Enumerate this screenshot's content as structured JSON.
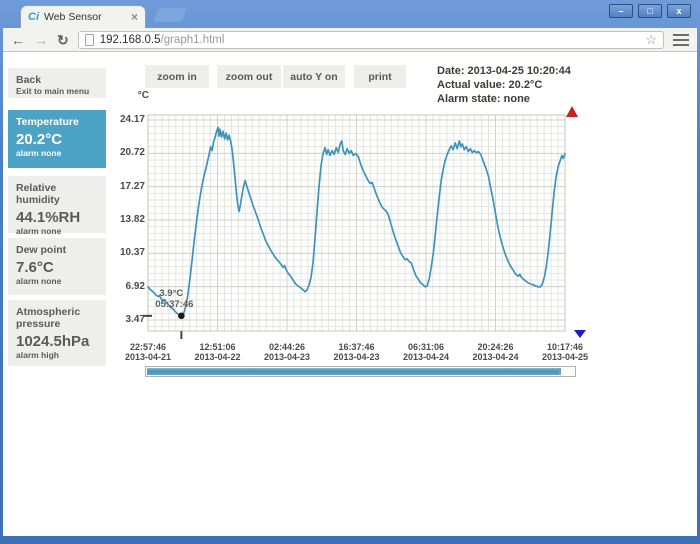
{
  "browser": {
    "tab_title": "Web Sensor",
    "url_host": "192.168.0.5",
    "url_path": "/graph1.html",
    "icons": {
      "favicon": "Ci",
      "tab_close": "×",
      "back": "←",
      "forward": "→",
      "reload": "↻",
      "star": "☆",
      "minimize": "–",
      "maximize": "□",
      "close": "x"
    }
  },
  "sidebar": {
    "back": {
      "label": "Back",
      "sublabel": "Exit to main menu"
    },
    "items": [
      {
        "label": "Temperature",
        "value": "20.2°C",
        "alarm": "alarm none",
        "selected": true
      },
      {
        "label": "Relative humidity",
        "value": "44.1%RH",
        "alarm": "alarm none",
        "selected": false
      },
      {
        "label": "Dew point",
        "value": "7.6°C",
        "alarm": "alarm none",
        "selected": false
      },
      {
        "label": "Atmospheric pressure",
        "value": "1024.5hPa",
        "alarm": "alarm high",
        "selected": false
      }
    ]
  },
  "buttons": [
    "zoom in",
    "zoom out",
    "auto Y on",
    "print"
  ],
  "status": {
    "date_line": "Date: 2013-04-25 10:20:44",
    "value_line": "Actual value: 20.2°C",
    "alarm_line": "Alarm state: none"
  },
  "colors": {
    "accent": "#4da3c6",
    "line": "#3e93bd",
    "up_arrow": "#c42420",
    "down_arrow": "#1d1dc4"
  },
  "chart_data": {
    "type": "line",
    "title": "",
    "xlabel": "",
    "ylabel": "°C",
    "unit_label": "°C",
    "grid": true,
    "legend": "none",
    "y_ticks": [
      24.17,
      20.72,
      17.27,
      13.82,
      10.37,
      6.92,
      3.47
    ],
    "y_tick_labels": [
      "24.17",
      "20.72",
      "17.27",
      "13.82",
      "10.37",
      "6.92",
      "3.47"
    ],
    "ylim": [
      2.3,
      24.6
    ],
    "x_hours_total": 83.333,
    "x_ticks": [
      {
        "time": "22:57:46",
        "date": "2013-04-21"
      },
      {
        "time": "12:51:06",
        "date": "2013-04-22"
      },
      {
        "time": "02:44:26",
        "date": "2013-04-23"
      },
      {
        "time": "16:37:46",
        "date": "2013-04-23"
      },
      {
        "time": "06:31:06",
        "date": "2013-04-24"
      },
      {
        "time": "20:24:26",
        "date": "2013-04-24"
      },
      {
        "time": "10:17:46",
        "date": "2013-04-25"
      }
    ],
    "marker": {
      "t": 6.67,
      "value": 3.9,
      "label_value": "3.9°C",
      "label_time": "05:37:46"
    },
    "h_scrollbar_fill_percent": 97,
    "series": [
      {
        "name": "Temperature",
        "color": "#3e93bd",
        "points": [
          [
            0,
            6.9
          ],
          [
            0.5,
            6.6
          ],
          [
            1,
            6.4
          ],
          [
            1.5,
            6.1
          ],
          [
            2,
            5.9
          ],
          [
            2.3,
            6.0
          ],
          [
            2.6,
            5.7
          ],
          [
            3,
            5.5
          ],
          [
            3.3,
            5.6
          ],
          [
            3.7,
            5.2
          ],
          [
            4,
            5.1
          ],
          [
            4.5,
            4.8
          ],
          [
            5,
            4.6
          ],
          [
            5.5,
            4.3
          ],
          [
            6,
            4.1
          ],
          [
            6.4,
            3.95
          ],
          [
            6.67,
            3.9
          ],
          [
            7,
            4.0
          ],
          [
            7.3,
            4.4
          ],
          [
            7.7,
            5.2
          ],
          [
            8,
            6.2
          ],
          [
            8.4,
            7.8
          ],
          [
            8.8,
            9.6
          ],
          [
            9.2,
            11.5
          ],
          [
            9.6,
            13.2
          ],
          [
            10,
            14.8
          ],
          [
            10.4,
            16.2
          ],
          [
            10.8,
            17.4
          ],
          [
            11.2,
            18.4
          ],
          [
            11.6,
            19.2
          ],
          [
            12,
            20.1
          ],
          [
            12.3,
            20.8
          ],
          [
            12.5,
            21.4
          ],
          [
            12.8,
            21.0
          ],
          [
            13.1,
            21.9
          ],
          [
            13.4,
            22.4
          ],
          [
            13.7,
            23.0
          ],
          [
            14,
            23.4
          ],
          [
            14.2,
            22.5
          ],
          [
            14.4,
            23.2
          ],
          [
            14.7,
            22.4
          ],
          [
            15,
            23.0
          ],
          [
            15.3,
            22.2
          ],
          [
            15.6,
            22.8
          ],
          [
            15.9,
            22.1
          ],
          [
            16.2,
            22.6
          ],
          [
            16.5,
            22.0
          ],
          [
            16.8,
            21.1
          ],
          [
            17.1,
            19.7
          ],
          [
            17.4,
            18.1
          ],
          [
            17.7,
            16.4
          ],
          [
            18,
            15.2
          ],
          [
            18.2,
            14.7
          ],
          [
            18.5,
            15.5
          ],
          [
            18.8,
            16.5
          ],
          [
            19.1,
            17.3
          ],
          [
            19.4,
            17.9
          ],
          [
            19.7,
            17.4
          ],
          [
            20,
            16.9
          ],
          [
            20.5,
            16.1
          ],
          [
            21,
            15.3
          ],
          [
            21.5,
            14.6
          ],
          [
            22,
            13.9
          ],
          [
            22.5,
            13.1
          ],
          [
            23,
            12.4
          ],
          [
            23.5,
            11.7
          ],
          [
            24,
            11.2
          ],
          [
            24.5,
            10.7
          ],
          [
            25,
            10.3
          ],
          [
            25.5,
            9.9
          ],
          [
            26,
            9.6
          ],
          [
            26.5,
            9.3
          ],
          [
            27,
            8.9
          ],
          [
            27.3,
            9.1
          ],
          [
            27.6,
            8.7
          ],
          [
            28,
            8.3
          ],
          [
            28.5,
            8.0
          ],
          [
            29,
            7.6
          ],
          [
            29.5,
            7.2
          ],
          [
            30,
            7.0
          ],
          [
            30.5,
            6.8
          ],
          [
            31,
            6.6
          ],
          [
            31.4,
            6.4
          ],
          [
            31.8,
            6.6
          ],
          [
            32.2,
            7.1
          ],
          [
            32.6,
            7.9
          ],
          [
            33,
            9.5
          ],
          [
            33.4,
            12.0
          ],
          [
            33.8,
            14.8
          ],
          [
            34.2,
            17.4
          ],
          [
            34.6,
            19.5
          ],
          [
            35,
            20.7
          ],
          [
            35.4,
            21.3
          ],
          [
            35.7,
            20.6
          ],
          [
            36,
            21.1
          ],
          [
            36.4,
            20.5
          ],
          [
            36.8,
            21.0
          ],
          [
            37.2,
            20.6
          ],
          [
            37.6,
            21.3
          ],
          [
            38,
            20.8
          ],
          [
            38.4,
            21.7
          ],
          [
            38.7,
            22.0
          ],
          [
            39,
            21.0
          ],
          [
            39.4,
            20.6
          ],
          [
            39.8,
            21.2
          ],
          [
            40.2,
            20.7
          ],
          [
            40.6,
            21.0
          ],
          [
            41,
            20.5
          ],
          [
            41.5,
            20.7
          ],
          [
            42,
            20.4
          ],
          [
            42.5,
            19.6
          ],
          [
            43,
            18.9
          ],
          [
            43.5,
            18.4
          ],
          [
            44,
            17.9
          ],
          [
            44.4,
            17.6
          ],
          [
            44.8,
            17.7
          ],
          [
            45.2,
            17.1
          ],
          [
            45.6,
            16.5
          ],
          [
            46,
            16.0
          ],
          [
            46.5,
            15.4
          ],
          [
            47,
            15.0
          ],
          [
            47.5,
            14.8
          ],
          [
            48,
            14.4
          ],
          [
            48.5,
            13.5
          ],
          [
            49,
            12.6
          ],
          [
            49.5,
            11.8
          ],
          [
            50,
            11.1
          ],
          [
            50.5,
            10.4
          ],
          [
            51,
            10.0
          ],
          [
            51.4,
            9.7
          ],
          [
            51.8,
            9.8
          ],
          [
            52.2,
            9.5
          ],
          [
            52.6,
            9.4
          ],
          [
            53,
            8.8
          ],
          [
            53.5,
            8.1
          ],
          [
            54,
            7.7
          ],
          [
            54.5,
            7.3
          ],
          [
            55,
            7.1
          ],
          [
            55.4,
            6.9
          ],
          [
            55.8,
            7.0
          ],
          [
            56.2,
            7.7
          ],
          [
            56.6,
            8.9
          ],
          [
            57,
            10.3
          ],
          [
            57.4,
            12.2
          ],
          [
            57.8,
            14.3
          ],
          [
            58.2,
            16.2
          ],
          [
            58.6,
            17.9
          ],
          [
            59,
            19.1
          ],
          [
            59.4,
            20.0
          ],
          [
            59.8,
            20.6
          ],
          [
            60.2,
            21.1
          ],
          [
            60.6,
            21.5
          ],
          [
            61,
            21.1
          ],
          [
            61.4,
            21.8
          ],
          [
            61.8,
            21.2
          ],
          [
            62.2,
            22.0
          ],
          [
            62.5,
            21.4
          ],
          [
            62.8,
            21.7
          ],
          [
            63.2,
            21.1
          ],
          [
            63.6,
            21.4
          ],
          [
            64,
            20.9
          ],
          [
            64.4,
            21.2
          ],
          [
            64.8,
            20.8
          ],
          [
            65.2,
            21.0
          ],
          [
            65.6,
            20.8
          ],
          [
            66,
            20.9
          ],
          [
            66.5,
            20.6
          ],
          [
            67,
            19.9
          ],
          [
            67.5,
            19.2
          ],
          [
            68,
            18.4
          ],
          [
            68.5,
            17.1
          ],
          [
            69,
            15.8
          ],
          [
            69.5,
            14.3
          ],
          [
            70,
            12.9
          ],
          [
            70.5,
            11.8
          ],
          [
            71,
            10.9
          ],
          [
            71.5,
            10.1
          ],
          [
            72,
            9.5
          ],
          [
            72.5,
            9.0
          ],
          [
            73,
            8.6
          ],
          [
            73.5,
            8.2
          ],
          [
            74,
            8.0
          ],
          [
            74.3,
            8.2
          ],
          [
            74.6,
            7.9
          ],
          [
            75,
            7.7
          ],
          [
            75.5,
            7.5
          ],
          [
            76,
            7.3
          ],
          [
            76.5,
            7.2
          ],
          [
            77,
            7.1
          ],
          [
            77.5,
            7.0
          ],
          [
            78,
            6.9
          ],
          [
            78.4,
            6.9
          ],
          [
            78.8,
            7.2
          ],
          [
            79.2,
            7.9
          ],
          [
            79.6,
            9.0
          ],
          [
            80,
            10.6
          ],
          [
            80.4,
            12.6
          ],
          [
            80.8,
            14.8
          ],
          [
            81.2,
            16.9
          ],
          [
            81.6,
            18.4
          ],
          [
            82,
            19.4
          ],
          [
            82.4,
            20.0
          ],
          [
            82.7,
            20.5
          ],
          [
            83,
            20.2
          ],
          [
            83.33,
            20.7
          ]
        ]
      }
    ]
  }
}
